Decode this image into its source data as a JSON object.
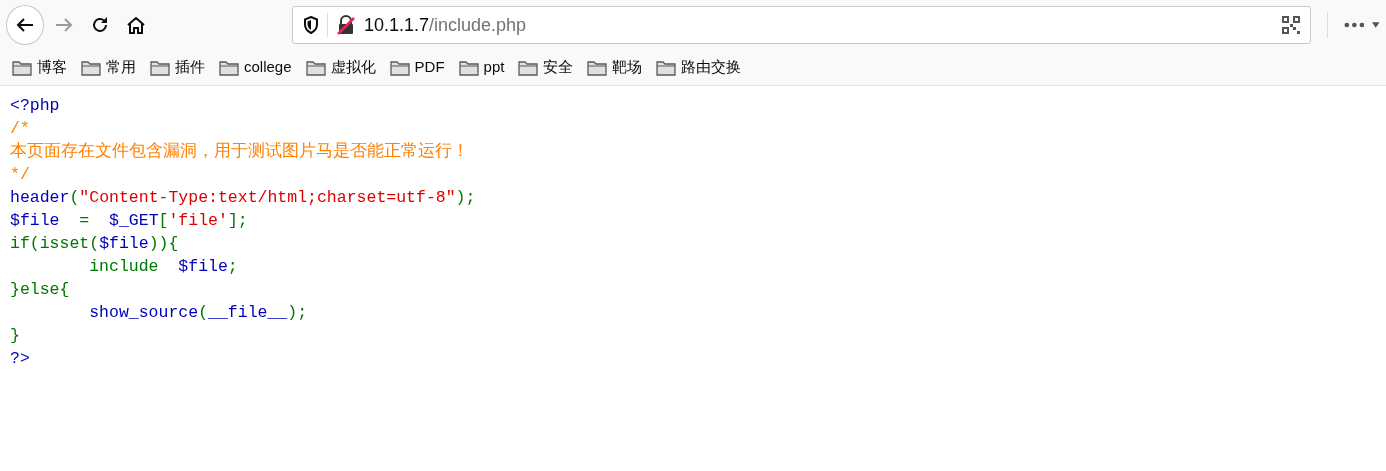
{
  "url": {
    "host": "10.1.1.7",
    "path": "/include.php"
  },
  "bookmarks": [
    "博客",
    "常用",
    "插件",
    "college",
    "虚拟化",
    "PDF",
    "ppt",
    "安全",
    "靶场",
    "路由交换"
  ],
  "code_lines": [
    {
      "tokens": [
        {
          "kind": "default",
          "text": "<?php"
        }
      ]
    },
    {
      "tokens": [
        {
          "kind": "comment",
          "text": "/*"
        }
      ]
    },
    {
      "tokens": [
        {
          "kind": "comment",
          "text": "本页面存在文件包含漏洞，用于测试图片马是否能正常运行！"
        }
      ]
    },
    {
      "tokens": [
        {
          "kind": "comment",
          "text": "*/"
        }
      ]
    },
    {
      "tokens": [
        {
          "kind": "default",
          "text": "header"
        },
        {
          "kind": "keyword",
          "text": "("
        },
        {
          "kind": "string",
          "text": "\"Content-Type:text/html;charset=utf-8\""
        },
        {
          "kind": "keyword",
          "text": ");"
        }
      ]
    },
    {
      "tokens": [
        {
          "kind": "default",
          "text": "$file"
        },
        {
          "kind": "keyword",
          "text": "  =  "
        },
        {
          "kind": "default",
          "text": "$_GET"
        },
        {
          "kind": "keyword",
          "text": "["
        },
        {
          "kind": "string",
          "text": "'file'"
        },
        {
          "kind": "keyword",
          "text": "];"
        }
      ]
    },
    {
      "tokens": [
        {
          "kind": "keyword",
          "text": "if(isset("
        },
        {
          "kind": "default",
          "text": "$file"
        },
        {
          "kind": "keyword",
          "text": ")){"
        }
      ]
    },
    {
      "tokens": [
        {
          "kind": "keyword",
          "text": "        include  "
        },
        {
          "kind": "default",
          "text": "$file"
        },
        {
          "kind": "keyword",
          "text": ";"
        }
      ]
    },
    {
      "tokens": [
        {
          "kind": "keyword",
          "text": "}else{"
        }
      ]
    },
    {
      "tokens": [
        {
          "kind": "default",
          "text": "        show_source"
        },
        {
          "kind": "keyword",
          "text": "("
        },
        {
          "kind": "default",
          "text": "__file__"
        },
        {
          "kind": "keyword",
          "text": ");"
        }
      ]
    },
    {
      "tokens": [
        {
          "kind": "keyword",
          "text": "}"
        }
      ]
    },
    {
      "tokens": [
        {
          "kind": "default",
          "text": "?>"
        }
      ]
    }
  ]
}
